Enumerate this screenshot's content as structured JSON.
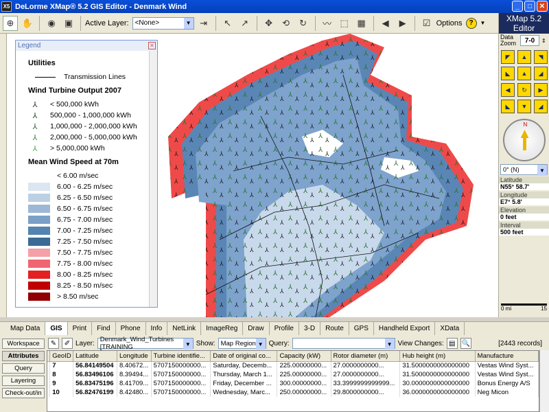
{
  "window": {
    "title": "DeLorme XMap® 5.2 GIS Editor - Denmark Wind",
    "app_icon": "X5"
  },
  "toolbar": {
    "active_layer_label": "Active Layer:",
    "active_layer_value": "<None>",
    "options_label": "Options"
  },
  "legend": {
    "title": "Legend",
    "sections": [
      {
        "heading": "Utilities",
        "items": [
          {
            "label": "Transmission Lines"
          }
        ]
      },
      {
        "heading": "Wind Turbine Output 2007",
        "items": [
          {
            "label": "< 500,000 kWh",
            "color": "#333333"
          },
          {
            "label": "500,000 - 1,000,000 kWh",
            "color": "#1f4d1f"
          },
          {
            "label": "1,000,000 - 2,000,000 kWh",
            "color": "#2b6b2b"
          },
          {
            "label": "2,000,000 - 5,000,000 kWh",
            "color": "#3d8a3d"
          },
          {
            "label": "> 5,000,000 kWh",
            "color": "#50a550"
          }
        ]
      },
      {
        "heading": "Mean Wind Speed at 70m",
        "items": [
          {
            "label": "< 6.00 m/sec",
            "color": "#ffffff"
          },
          {
            "label": "6.00 - 6.25 m/sec",
            "color": "#dce6f0"
          },
          {
            "label": "6.25 - 6.50 m/sec",
            "color": "#bcd0e4"
          },
          {
            "label": "6.50  - 6.75 m/sec",
            "color": "#9cb8d6"
          },
          {
            "label": "6.75 - 7.00 m/sec",
            "color": "#7aa0c6"
          },
          {
            "label": "7.00 - 7.25 m/sec",
            "color": "#5584b0"
          },
          {
            "label": "7.25  - 7.50 m/sec",
            "color": "#3b6a96"
          },
          {
            "label": "7.50 - 7.75 m/sec",
            "color": "#f4a0a8"
          },
          {
            "label": "7.75 - 8.00 m/sec",
            "color": "#ef6670"
          },
          {
            "label": "8.00 - 8.25 m/sec",
            "color": "#e52020"
          },
          {
            "label": "8.25 - 8.50 m/sec",
            "color": "#c00000"
          },
          {
            "label": "> 8.50 m/sec",
            "color": "#900000"
          }
        ]
      }
    ]
  },
  "right_panel": {
    "logo_line1": "XMap 5.2",
    "logo_line2": "Editor",
    "zoom_label": "Data Zoom",
    "zoom_value": "7-0",
    "heading_value": "0° (N)",
    "latitude_label": "Latitude",
    "latitude_value": "N55° 58.7'",
    "longitude_label": "Longitude",
    "longitude_value": "E7° 5.8'",
    "elevation_label": "Elevation",
    "elevation_value": "0 feet",
    "interval_label": "Interval",
    "interval_value": "500 feet",
    "scale_left": "0 mi",
    "scale_right": "15"
  },
  "tabs": [
    "Map Data",
    "GIS",
    "Print",
    "Find",
    "Phone",
    "Info",
    "NetLink",
    "ImageReg",
    "Draw",
    "Profile",
    "3-D",
    "Route",
    "GPS",
    "Handheld Export",
    "XData"
  ],
  "active_tab": "GIS",
  "side_buttons": [
    "Workspace",
    "Attributes",
    "Query",
    "Layering",
    "Check-out/in"
  ],
  "attr_toolbar": {
    "layer_label": "Layer:",
    "layer_value": "Denmark_Wind_Turbines [TRAINING",
    "show_label": "Show:",
    "show_value": "Map Region",
    "query_label": "Query:",
    "query_value": "",
    "view_changes_label": "View Changes:",
    "records": "[2443 records]"
  },
  "table": {
    "columns": [
      "",
      "GeoID",
      "Latitude",
      "Longitude",
      "Turbine identifie...",
      "Date of original co...",
      "Capacity (kW)",
      "Rotor diameter (m)",
      "Hub height (m)",
      "Manufacture"
    ],
    "rows": [
      [
        "",
        "7",
        "56.84149504",
        "8.40672...",
        "5707150000000...",
        "Saturday, Decemb...",
        "225.00000000...",
        "27.0000000000...",
        "31.5000000000000000",
        "Vestas Wind Syst..."
      ],
      [
        "",
        "8",
        "56.83496106",
        "8.39494...",
        "5707150000000...",
        "Thursday, March 1...",
        "225.00000000...",
        "27.0000000000...",
        "31.5000000000000000",
        "Vestas Wind Syst..."
      ],
      [
        "",
        "9",
        "56.83475196",
        "8.41709...",
        "5707150000000...",
        "Friday, December ...",
        "300.00000000...",
        "33.3999999999999...",
        "30.0000000000000000",
        "Bonus Energy A/S"
      ],
      [
        "",
        "10",
        "56.82476199",
        "8.42480...",
        "5707150000000...",
        "Wednesday, Marc...",
        "250.00000000...",
        "29.8000000000...",
        "36.0000000000000000",
        "Neg Micon"
      ]
    ]
  }
}
